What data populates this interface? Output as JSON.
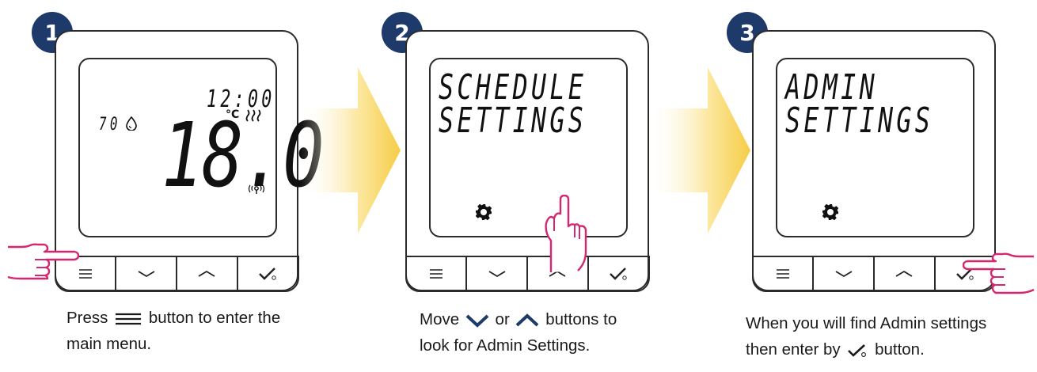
{
  "steps": [
    {
      "number": "1",
      "display": {
        "time": "12:00",
        "humidity": "70",
        "unit": "°C",
        "temperature": "18.0"
      },
      "caption": {
        "pre": "Press",
        "post": "button to enter the",
        "line2": "main menu."
      }
    },
    {
      "number": "2",
      "display": {
        "line1": "SCHEDULE",
        "line2": "SETTINGS"
      },
      "caption": {
        "pre": "Move",
        "mid": "or",
        "post": "buttons to",
        "line2": "look for Admin Settings."
      }
    },
    {
      "number": "3",
      "display": {
        "line1": "ADMIN",
        "line2": "SETTINGS"
      },
      "caption": {
        "line1": "When you will find Admin settings",
        "pre": "then enter by",
        "post": "button."
      }
    }
  ],
  "colors": {
    "badge": "#1d3a6b",
    "hand": "#d6266f",
    "arrow": "#f7d054",
    "outline": "#2b2b2b"
  },
  "icons": [
    "menu-icon",
    "chevron-down-icon",
    "chevron-up-icon",
    "check-power-icon",
    "gear-icon",
    "humidity-drop-icon",
    "heating-icon",
    "wireless-icon",
    "hand-pointer-icon"
  ]
}
